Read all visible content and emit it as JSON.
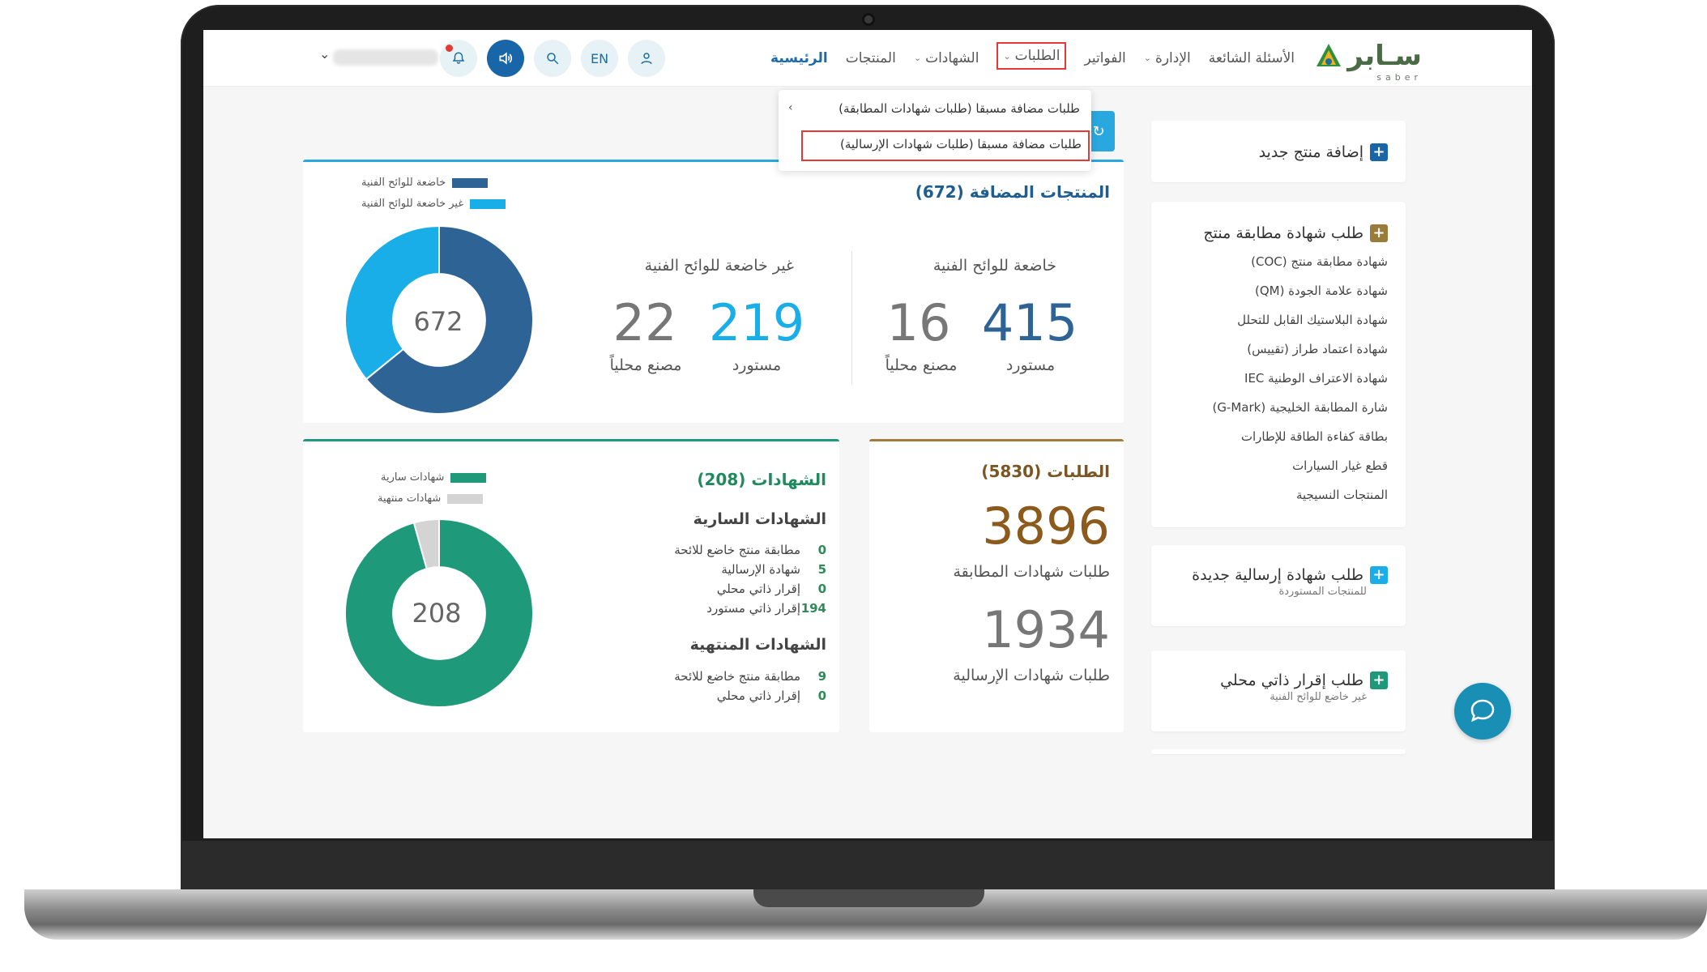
{
  "header": {
    "logo_text": "سـابر",
    "logo_sub": "saber",
    "nav": [
      {
        "label": "الرئيسية",
        "active": true,
        "chevron": false
      },
      {
        "label": "المنتجات",
        "active": false,
        "chevron": false
      },
      {
        "label": "الشهادات",
        "active": false,
        "chevron": true
      },
      {
        "label": "الطلبات",
        "active": false,
        "chevron": true,
        "highlighted": true
      },
      {
        "label": "الفواتير",
        "active": false,
        "chevron": false
      },
      {
        "label": "الإدارة",
        "active": false,
        "chevron": true
      },
      {
        "label": "الأسئلة الشائعة",
        "active": false,
        "chevron": false
      }
    ],
    "lang_label": "EN",
    "icons": [
      "bell-icon",
      "speaker-icon",
      "search-icon",
      "user-icon"
    ]
  },
  "dropdown": {
    "item1": "طلبات مضافة مسبقا (طلبات شهادات المطابقة)",
    "item2": "طلبات مضافة مسبقا (طلبات شهادات الإرسالية)"
  },
  "sidebar": {
    "add_product": "إضافة منتج جديد",
    "coc_request": "طلب شهادة مطابقة منتج",
    "coc_items": [
      "شهادة مطابقة منتج (COC)",
      "شهادة علامة الجودة (QM)",
      "شهادة البلاستيك القابل للتحلل",
      "شهادة اعتماد طراز (تقييس)",
      "شهادة الاعتراف الوطنية IEC",
      "شارة المطابقة الخليجية (G-Mark)",
      "بطاقة كفاءة الطاقة للإطارات",
      "قطع غيار السيارات",
      "المنتجات النسيجية"
    ],
    "shipment_request": "طلب شهادة إرسالية جديدة",
    "shipment_sub": "للمنتجات المستوردة",
    "self_declaration": "طلب إقرار ذاتي محلي",
    "self_declaration_sub": "غير خاضع للوائح الفنية"
  },
  "products_card": {
    "title": "المنتجات المضافة (672)",
    "subject_header": "خاضعة للوائح الفنية",
    "not_subject_header": "غير خاضعة للوائح الفنية",
    "subject_imported": "415",
    "subject_local": "16",
    "not_subject_imported": "219",
    "not_subject_local": "22",
    "imported_label": "مستورد",
    "local_label": "مصنع محلياً",
    "legend_subject": "خاضعة للوائح الفنية",
    "legend_not_subject": "غير خاضعة للوائح الفنية",
    "donut_total": "672"
  },
  "requests_card": {
    "title": "الطلبات (5830)",
    "coc_count": "3896",
    "coc_label": "طلبات شهادات المطابقة",
    "shipment_count": "1934",
    "shipment_label": "طلبات شهادات الإرسالية"
  },
  "certs_card": {
    "title": "الشهادات (208)",
    "active_head": "الشهادات السارية",
    "active_rows": [
      {
        "count": "0",
        "label": "مطابقة منتج خاضع للائحة"
      },
      {
        "count": "5",
        "label": "شهادة الإرسالية"
      },
      {
        "count": "0",
        "label": "إقرار ذاتي محلي"
      },
      {
        "count": "194",
        "label": "إقرار ذاتي مستورد"
      }
    ],
    "expired_head": "الشهادات المنتهية",
    "expired_rows": [
      {
        "count": "9",
        "label": "مطابقة منتج خاضع للائحة"
      },
      {
        "count": "0",
        "label": "إقرار ذاتي محلي"
      }
    ],
    "legend_active": "شهادات سارية",
    "legend_expired": "شهادات منتهية",
    "donut_total": "208"
  },
  "colors": {
    "primary": "#1865a8",
    "light_blue": "#1aaee8",
    "dark_blue": "#2e6395",
    "green": "#1e9a7a",
    "brown": "#8b5a1c",
    "gray_donut": "#d4d4d4",
    "highlight": "#e53935"
  },
  "chart_data": [
    {
      "type": "pie",
      "labels": [
        "خاضعة للوائح الفنية",
        "غير خاضعة للوائح الفنية"
      ],
      "values": [
        431,
        241
      ],
      "center_label": "672"
    },
    {
      "type": "pie",
      "labels": [
        "شهادات سارية",
        "شهادات منتهية"
      ],
      "values": [
        199,
        9
      ],
      "center_label": "208"
    }
  ]
}
